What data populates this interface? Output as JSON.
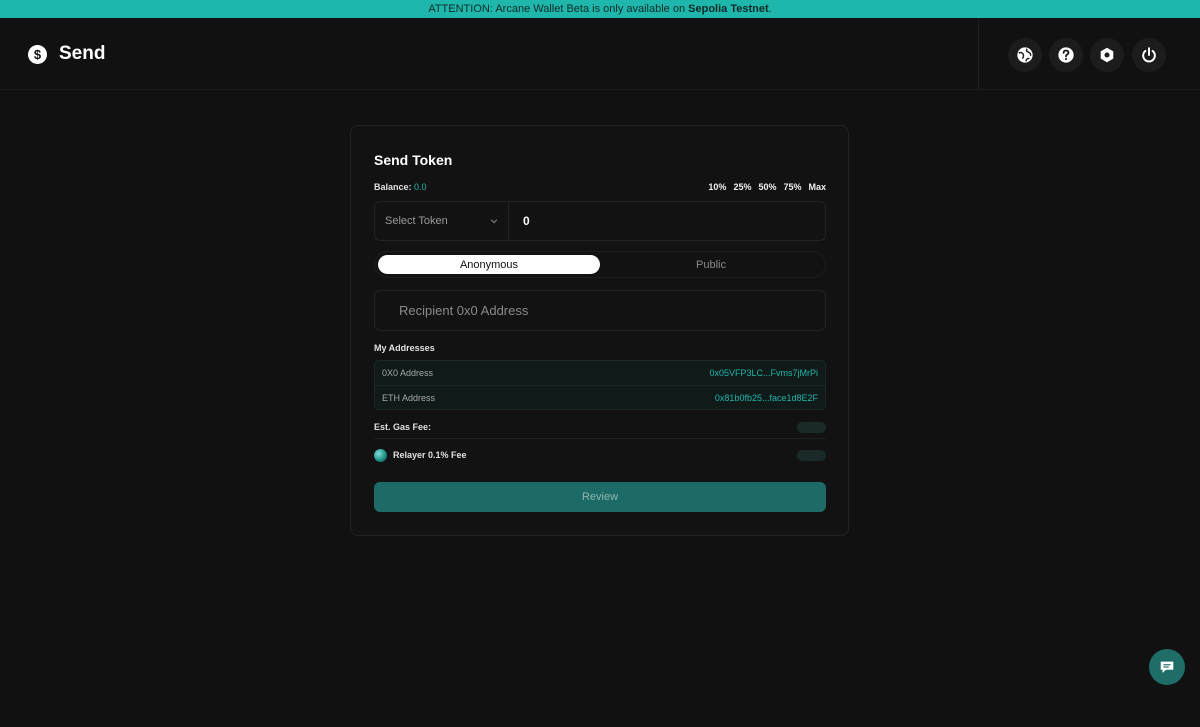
{
  "banner": {
    "prefix": "ATTENTION: Arcane Wallet Beta is only available on ",
    "network": "Sepolia Testnet",
    "suffix": "."
  },
  "header": {
    "title": "Send",
    "title_icon": "dollar-circle-icon",
    "buttons": [
      "globe-icon",
      "help-icon",
      "settings-icon",
      "power-icon"
    ]
  },
  "card": {
    "title": "Send Token",
    "balance_label": "Balance:",
    "balance_value": "0.0",
    "percentages": [
      "10%",
      "25%",
      "50%",
      "75%",
      "Max"
    ],
    "token_placeholder": "Select Token",
    "amount": "0",
    "modes": [
      "Anonymous",
      "Public"
    ],
    "active_mode": "Anonymous",
    "recipient_placeholder": "Recipient 0x0 Address",
    "my_addresses_label": "My Addresses",
    "addresses": [
      {
        "label": "0X0 Address",
        "value": "0x05VFP3LC...Fvms7jMrPi"
      },
      {
        "label": "ETH Address",
        "value": "0x81b0fb25...face1d8E2F"
      }
    ],
    "gas_fee_label": "Est. Gas Fee:",
    "relayer_fee_label": "Relayer 0.1% Fee",
    "review_label": "Review"
  },
  "colors": {
    "accent": "#1fb7ab",
    "background": "#111111",
    "review_button": "#1d6b66"
  }
}
